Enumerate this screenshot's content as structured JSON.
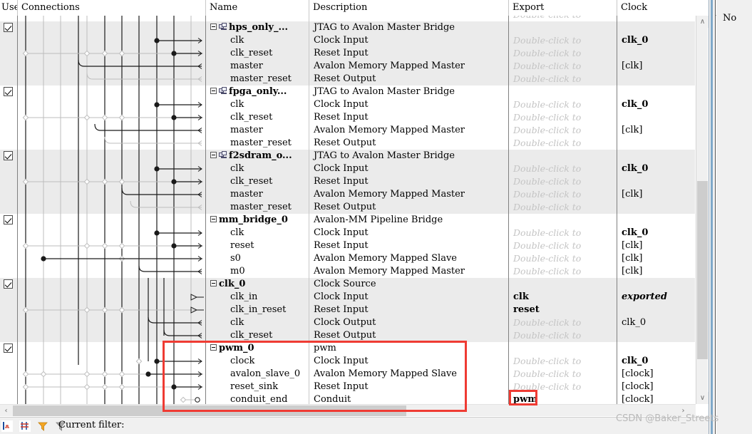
{
  "window": {
    "app": "platform-designer-system-contents"
  },
  "columns": [
    {
      "key": "use",
      "label": "Use"
    },
    {
      "key": "connections",
      "label": "Connections"
    },
    {
      "key": "name",
      "label": "Name"
    },
    {
      "key": "description",
      "label": "Description"
    },
    {
      "key": "export",
      "label": "Export"
    },
    {
      "key": "clock",
      "label": "Clock"
    }
  ],
  "export_placeholder": "Double-click to",
  "rows": [
    {
      "kind": "partial",
      "use": false,
      "name": "",
      "description": "",
      "export": "Double-click to",
      "export_style": "placeholder",
      "clock": "",
      "clock_style": "normal",
      "shaded": false
    },
    {
      "kind": "module",
      "use": true,
      "name": "hps_only_...",
      "description": "JTAG to Avalon Master Bridge",
      "export": "",
      "export_style": "none",
      "clock": "",
      "clock_style": "none",
      "shaded": true
    },
    {
      "kind": "port",
      "use": false,
      "name": "clk",
      "description": "Clock Input",
      "export": "Double-click to",
      "export_style": "placeholder",
      "clock": "clk_0",
      "clock_style": "strong",
      "shaded": true
    },
    {
      "kind": "port",
      "use": false,
      "name": "clk_reset",
      "description": "Reset Input",
      "export": "Double-click to",
      "export_style": "placeholder",
      "clock": "",
      "clock_style": "none",
      "shaded": true
    },
    {
      "kind": "port",
      "use": false,
      "name": "master",
      "description": "Avalon Memory Mapped Master",
      "export": "Double-click to",
      "export_style": "placeholder",
      "clock": "[clk]",
      "clock_style": "normal",
      "shaded": true
    },
    {
      "kind": "port",
      "use": false,
      "name": "master_reset",
      "description": "Reset Output",
      "export": "Double-click to",
      "export_style": "placeholder",
      "clock": "",
      "clock_style": "none",
      "shaded": true
    },
    {
      "kind": "module",
      "use": true,
      "name": "fpga_only...",
      "description": "JTAG to Avalon Master Bridge",
      "export": "",
      "export_style": "none",
      "clock": "",
      "clock_style": "none",
      "shaded": false
    },
    {
      "kind": "port",
      "use": false,
      "name": "clk",
      "description": "Clock Input",
      "export": "Double-click to",
      "export_style": "placeholder",
      "clock": "clk_0",
      "clock_style": "strong",
      "shaded": false
    },
    {
      "kind": "port",
      "use": false,
      "name": "clk_reset",
      "description": "Reset Input",
      "export": "Double-click to",
      "export_style": "placeholder",
      "clock": "",
      "clock_style": "none",
      "shaded": false
    },
    {
      "kind": "port",
      "use": false,
      "name": "master",
      "description": "Avalon Memory Mapped Master",
      "export": "Double-click to",
      "export_style": "placeholder",
      "clock": "[clk]",
      "clock_style": "normal",
      "shaded": false
    },
    {
      "kind": "port",
      "use": false,
      "name": "master_reset",
      "description": "Reset Output",
      "export": "Double-click to",
      "export_style": "placeholder",
      "clock": "",
      "clock_style": "none",
      "shaded": false
    },
    {
      "kind": "module",
      "use": true,
      "name": "f2sdram_o...",
      "description": "JTAG to Avalon Master Bridge",
      "export": "",
      "export_style": "none",
      "clock": "",
      "clock_style": "none",
      "shaded": true
    },
    {
      "kind": "port",
      "use": false,
      "name": "clk",
      "description": "Clock Input",
      "export": "Double-click to",
      "export_style": "placeholder",
      "clock": "clk_0",
      "clock_style": "strong",
      "shaded": true
    },
    {
      "kind": "port",
      "use": false,
      "name": "clk_reset",
      "description": "Reset Input",
      "export": "Double-click to",
      "export_style": "placeholder",
      "clock": "",
      "clock_style": "none",
      "shaded": true
    },
    {
      "kind": "port",
      "use": false,
      "name": "master",
      "description": "Avalon Memory Mapped Master",
      "export": "Double-click to",
      "export_style": "placeholder",
      "clock": "[clk]",
      "clock_style": "normal",
      "shaded": true
    },
    {
      "kind": "port",
      "use": false,
      "name": "master_reset",
      "description": "Reset Output",
      "export": "Double-click to",
      "export_style": "placeholder",
      "clock": "",
      "clock_style": "none",
      "shaded": true
    },
    {
      "kind": "module-plain",
      "use": true,
      "name": "mm_bridge_0",
      "description": "Avalon-MM Pipeline Bridge",
      "export": "",
      "export_style": "none",
      "clock": "",
      "clock_style": "none",
      "shaded": false
    },
    {
      "kind": "port",
      "use": false,
      "name": "clk",
      "description": "Clock Input",
      "export": "Double-click to",
      "export_style": "placeholder",
      "clock": "clk_0",
      "clock_style": "strong",
      "shaded": false
    },
    {
      "kind": "port",
      "use": false,
      "name": "reset",
      "description": "Reset Input",
      "export": "Double-click to",
      "export_style": "placeholder",
      "clock": "[clk]",
      "clock_style": "normal",
      "shaded": false
    },
    {
      "kind": "port",
      "use": false,
      "name": "s0",
      "description": "Avalon Memory Mapped Slave",
      "export": "Double-click to",
      "export_style": "placeholder",
      "clock": "[clk]",
      "clock_style": "normal",
      "shaded": false
    },
    {
      "kind": "port",
      "use": false,
      "name": "m0",
      "description": "Avalon Memory Mapped Master",
      "export": "Double-click to",
      "export_style": "placeholder",
      "clock": "[clk]",
      "clock_style": "normal",
      "shaded": false
    },
    {
      "kind": "module-plain",
      "use": true,
      "name": "clk_0",
      "description": "Clock Source",
      "export": "",
      "export_style": "none",
      "clock": "",
      "clock_style": "none",
      "shaded": true
    },
    {
      "kind": "port",
      "use": false,
      "name": "clk_in",
      "description": "Clock Input",
      "export": "clk",
      "export_style": "named",
      "clock": "exported",
      "clock_style": "exported",
      "shaded": true
    },
    {
      "kind": "port",
      "use": false,
      "name": "clk_in_reset",
      "description": "Reset Input",
      "export": "reset",
      "export_style": "named",
      "clock": "",
      "clock_style": "none",
      "shaded": true
    },
    {
      "kind": "port",
      "use": false,
      "name": "clk",
      "description": "Clock Output",
      "export": "Double-click to",
      "export_style": "placeholder",
      "clock": "clk_0",
      "clock_style": "normal",
      "shaded": true
    },
    {
      "kind": "port",
      "use": false,
      "name": "clk_reset",
      "description": "Reset Output",
      "export": "Double-click to",
      "export_style": "placeholder",
      "clock": "",
      "clock_style": "none",
      "shaded": true
    },
    {
      "kind": "module-plain",
      "use": true,
      "name": "pwm_0",
      "description": "pwm",
      "export": "",
      "export_style": "none",
      "clock": "",
      "clock_style": "none",
      "shaded": false
    },
    {
      "kind": "port",
      "use": false,
      "name": "clock",
      "description": "Clock Input",
      "export": "Double-click to",
      "export_style": "placeholder",
      "clock": "clk_0",
      "clock_style": "strong",
      "shaded": false
    },
    {
      "kind": "port",
      "use": false,
      "name": "avalon_slave_0",
      "description": "Avalon Memory Mapped Slave",
      "export": "Double-click to",
      "export_style": "placeholder",
      "clock": "[clock]",
      "clock_style": "normal",
      "shaded": false
    },
    {
      "kind": "port",
      "use": false,
      "name": "reset_sink",
      "description": "Reset Input",
      "export": "Double-click to",
      "export_style": "placeholder",
      "clock": "[clock]",
      "clock_style": "normal",
      "shaded": false
    },
    {
      "kind": "port",
      "use": false,
      "name": "conduit_end",
      "description": "Conduit",
      "export": "pwm",
      "export_style": "named",
      "clock": "[clock]",
      "clock_style": "normal",
      "shaded": false
    }
  ],
  "scrollbars": {
    "up_arrow": "∧",
    "down_arrow": "∨",
    "left_arrow": "‹",
    "right_arrow": "›"
  },
  "bottom_toolbar": {
    "filter_label": "Current filter:",
    "icons": [
      "add-signal-icon",
      "remove-signal-icon",
      "filter-active-icon",
      "filter-inactive-icon"
    ]
  },
  "side_panel": {
    "text": "No"
  },
  "watermark": {
    "text": "CSDN @Baker_Streets"
  },
  "annotations": {
    "highlight_color": "#ef3b33",
    "boxes": [
      {
        "name": "pwm-module-highlight",
        "target": "pwm_0 module rows"
      },
      {
        "name": "pwm-export-highlight",
        "target": "pwm export cell"
      }
    ]
  }
}
